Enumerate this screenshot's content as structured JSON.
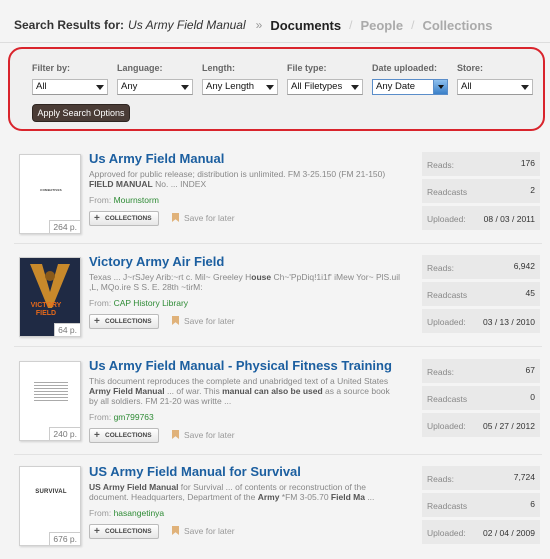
{
  "breadcrumb": {
    "label": "Search Results for:",
    "query": "Us Army Field Manual",
    "separator": "»",
    "active": "Documents",
    "items": [
      "People",
      "Collections"
    ],
    "slash": "/"
  },
  "filters": {
    "filter_by": {
      "label": "Filter by:",
      "value": "All"
    },
    "language": {
      "label": "Language:",
      "value": "Any"
    },
    "length": {
      "label": "Length:",
      "value": "Any Length"
    },
    "file_type": {
      "label": "File type:",
      "value": "All Filetypes"
    },
    "date_uploaded": {
      "label": "Date uploaded:",
      "value": "Any Date"
    },
    "store": {
      "label": "Store:",
      "value": "All"
    },
    "apply_label": "Apply Search Options"
  },
  "labels": {
    "from": "From:",
    "collections": "COLLECTIONS",
    "save_later": "Save for later",
    "reads": "Reads:",
    "readcasts": "Readcasts",
    "uploaded": "Uploaded:"
  },
  "results": [
    {
      "title": "Us Army Field Manual",
      "desc_a": "Approved for public release; distribution is unlimited. FM 3-25.150 (FM 21-150)",
      "desc_b_bold": "FIELD MANUAL",
      "desc_b": " No. ... INDEX",
      "from": "Mournstorm",
      "pages": "264 p.",
      "thumb_text": "COMBATIVES",
      "reads": "176",
      "readcasts": "2",
      "uploaded": "08 / 03 / 2011"
    },
    {
      "title": "Victory Army Air Field",
      "desc_a": "Texas ... J~rSJey Arib:~rt c. Mil~ Greeley H",
      "desc_a_bold": "ouse",
      "desc_a_rest": " Ch~'PpDiq!1i1f' iMew Yor~ PlS.uil",
      "desc_b": ",L, MQo.ire S S. E. 28th ~tirM:",
      "from": "CAP History Library",
      "pages": "64 p.",
      "thumb_text": "VICTORY FIELD",
      "reads": "6,942",
      "readcasts": "45",
      "uploaded": "03 / 13 / 2010"
    },
    {
      "title": "Us Army Field Manual - Physical Fitness Training",
      "desc_a": "This document reproduces the complete and unabridged text of a United States",
      "desc_b_bold1": "Army Field Manual",
      "desc_b_mid": " ... of war. This ",
      "desc_b_bold2": "manual can also be used",
      "desc_b_end": " as a source book",
      "desc_c": "by all soldiers. FM 21-20 was writte ...",
      "from": "gm799763",
      "pages": "240 p.",
      "reads": "67",
      "readcasts": "0",
      "uploaded": "05 / 27 / 2012"
    },
    {
      "title": "US Army Field Manual for Survival",
      "desc_a_bold": "US Army Field Manual",
      "desc_a": " for Survival ... of contents or reconstruction of the",
      "desc_b": "document. Headquarters, Department of the ",
      "desc_b_bold1": "Army",
      "desc_b_mid": " *FM 3-05.70 ",
      "desc_b_bold2": "Field Ma",
      "desc_b_end": " ...",
      "from": "hasangetinya",
      "pages": "676 p.",
      "thumb_text": "SURVIVAL",
      "reads": "7,724",
      "readcasts": "6",
      "uploaded": "02 / 04 / 2009"
    }
  ],
  "colors": {
    "highlight_border": "#d9242c",
    "title_link": "#1c5fa0",
    "user_link": "#2e8b35"
  }
}
